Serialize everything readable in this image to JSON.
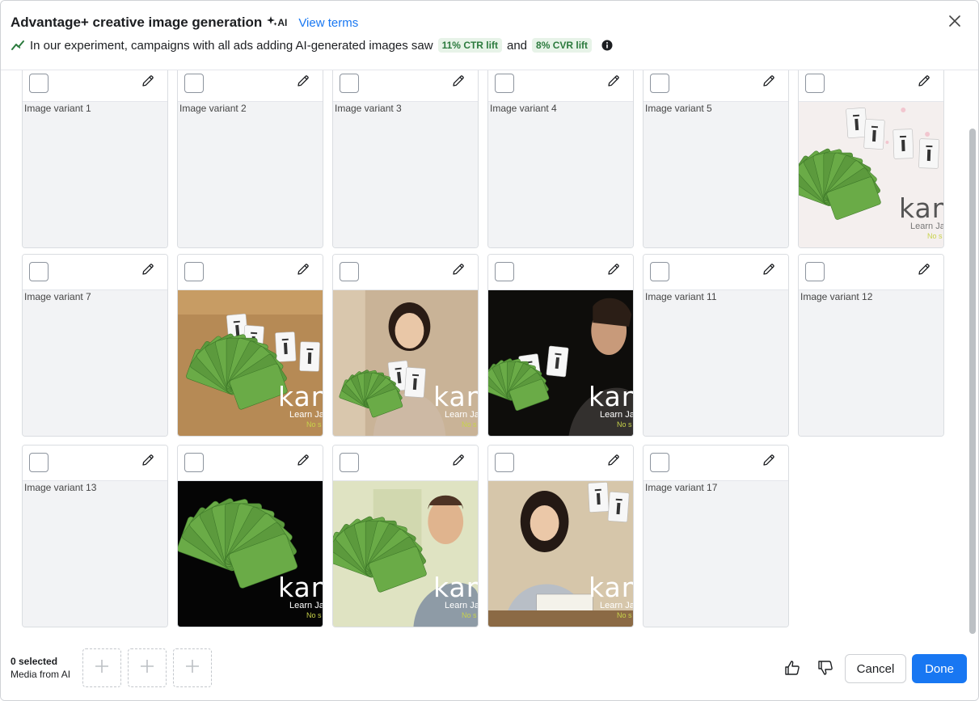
{
  "header": {
    "title": "Advantage+ creative image generation",
    "ai_badge": "AI",
    "view_terms": "View terms",
    "subtitle": "In our experiment, campaigns with all ads adding AI-generated images saw",
    "ctr_badge": "11% CTR lift",
    "and_text": "and",
    "cvr_badge": "8% CVR lift"
  },
  "brand": {
    "name": "kanj",
    "sub": "Learn Ja",
    "tag": "No s"
  },
  "cards": [
    {
      "alt": "Image variant 1",
      "image": null
    },
    {
      "alt": "Image variant 2",
      "image": null
    },
    {
      "alt": "Image variant 3",
      "image": null
    },
    {
      "alt": "Image variant 4",
      "image": null
    },
    {
      "alt": "Image variant 5",
      "image": null
    },
    {
      "alt": "",
      "image": "flashcards-blossom-light"
    },
    {
      "alt": "Image variant 7",
      "image": null
    },
    {
      "alt": "",
      "image": "flashcards-on-wood-table"
    },
    {
      "alt": "",
      "image": "woman-holding-flashcards"
    },
    {
      "alt": "",
      "image": "man-reading-flashcard-dark"
    },
    {
      "alt": "Image variant 11",
      "image": null
    },
    {
      "alt": "Image variant 12",
      "image": null
    },
    {
      "alt": "Image variant 13",
      "image": null
    },
    {
      "alt": "",
      "image": "flashcards-on-black"
    },
    {
      "alt": "",
      "image": "man-smiling-with-flashcards"
    },
    {
      "alt": "",
      "image": "woman-writing-notebook"
    },
    {
      "alt": "Image variant 17",
      "image": null
    }
  ],
  "footer": {
    "selected": "0 selected",
    "source": "Media from AI",
    "cancel": "Cancel",
    "done": "Done"
  },
  "colors": {
    "primary": "#1877f2",
    "lift_bg": "#e7f3e8",
    "lift_text": "#2b7a3d",
    "card_green": "#5c9a3d"
  }
}
